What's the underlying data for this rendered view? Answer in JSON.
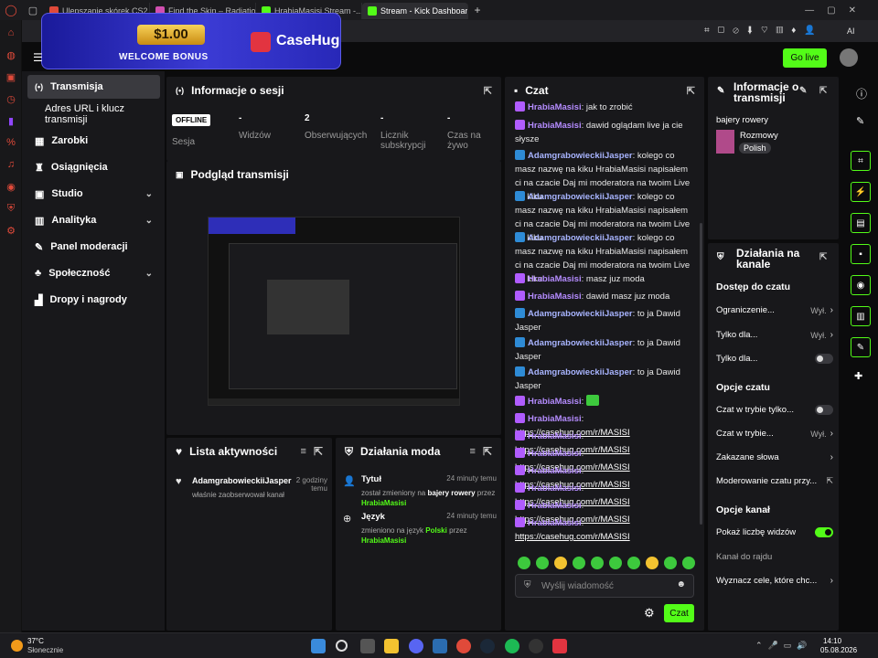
{
  "browser": {
    "tabs": [
      {
        "label": "Ulepszanie skórek CS2 i ul...",
        "color": "#e04a3a"
      },
      {
        "label": "Find the Skin – Radiation S...",
        "color": "#d04fb0"
      },
      {
        "label": "HrabiaMasisi Stream -...",
        "color": "#53fc18"
      },
      {
        "label": "Stream - Kick Dashboard",
        "color": "#53fc18"
      }
    ],
    "address_ai": "AI"
  },
  "banner": {
    "amount": "$1.00",
    "subtitle": "WELCOME BONUS",
    "brand": "CaseHug"
  },
  "header": {
    "go_live": "Go live"
  },
  "nav": {
    "items": [
      {
        "label": "Transmisja",
        "icon": "broadcast-icon"
      },
      {
        "label": "Adres URL i klucz transmisji"
      },
      {
        "label": "Zarobki",
        "icon": "chart-icon"
      },
      {
        "label": "Osiągnięcia",
        "icon": "trophy-icon"
      },
      {
        "label": "Studio",
        "icon": "studio-icon"
      },
      {
        "label": "Analityka",
        "icon": "analytics-icon"
      },
      {
        "label": "Panel moderacji",
        "icon": "wrench-icon"
      },
      {
        "label": "Społeczność",
        "icon": "community-icon"
      },
      {
        "label": "Dropy i nagrody",
        "icon": "gift-icon"
      }
    ]
  },
  "session": {
    "title": "Informacje o sesji",
    "status": "OFFLINE",
    "session_label": "Sesja",
    "stats": [
      {
        "value": "-",
        "label": "Widzów"
      },
      {
        "value": "2",
        "label": "Obserwujących"
      },
      {
        "value": "-",
        "label": "Licznik subskrypcji"
      },
      {
        "value": "-",
        "label": "Czas na żywo"
      }
    ]
  },
  "preview": {
    "title": "Podgląd transmisji"
  },
  "activity": {
    "title": "Lista aktywności",
    "items": [
      {
        "user": "AdamgrabowieckiiJasper",
        "text": "właśnie zaobserwował kanał",
        "time": "2 godziny temu"
      }
    ]
  },
  "modactions": {
    "title": "Działania moda",
    "items": [
      {
        "title": "Tytuł",
        "time": "24 minuty temu",
        "pre": "został zmieniony na",
        "value": "bajery rowery",
        "mid": "przez",
        "user": "HrabiaMasisi"
      },
      {
        "title": "Język",
        "time": "24 minuty temu",
        "pre": "zmieniono na język",
        "value": "Polski",
        "mid": "przez",
        "user": "HrabiaMasisi"
      }
    ]
  },
  "chat": {
    "title": "Czat",
    "messages": [
      {
        "user": "HrabiaMasisi",
        "badge": "purple",
        "text": ": jak to zrobić"
      },
      {
        "user": "HrabiaMasisi",
        "badge": "purple",
        "text": ": dawid oglądam live ja cie słysze"
      },
      {
        "user": "AdamgrabowieckiiJasper",
        "badge": "blue",
        "text": ": kolego co masz nazwę na kiku HrabiaMasisi napisałem ci na czacie Daj mi moderatora na twoim Live na kiku"
      },
      {
        "user": "AdamgrabowieckiiJasper",
        "badge": "blue",
        "text": ": kolego co masz nazwę na kiku HrabiaMasisi napisałem ci na czacie Daj mi moderatora na twoim Live na kiku"
      },
      {
        "user": "AdamgrabowieckiiJasper",
        "badge": "blue",
        "text": ": kolego co masz nazwę na kiku HrabiaMasisi napisałem ci na czacie Daj mi moderatora na twoim Live na kiku"
      },
      {
        "user": "HrabiaMasisi",
        "badge": "purple",
        "text": ": masz juz moda"
      },
      {
        "user": "HrabiaMasisi",
        "badge": "purple",
        "text": ": dawid masz juz moda"
      },
      {
        "user": "AdamgrabowieckiiJasper",
        "badge": "blue",
        "text": ": to ja Dawid Jasper"
      },
      {
        "user": "AdamgrabowieckiiJasper",
        "badge": "blue",
        "text": ": to ja Dawid Jasper"
      },
      {
        "user": "AdamgrabowieckiiJasper",
        "badge": "blue",
        "text": ": to ja Dawid Jasper"
      },
      {
        "user": "HrabiaMasisi",
        "badge": "purple",
        "text": ":",
        "emote": true
      },
      {
        "user": "HrabiaMasisi",
        "badge": "purple",
        "text": ": ",
        "link": "https://casehug.com/r/MASISI"
      },
      {
        "user": "HrabiaMasisi",
        "badge": "purple",
        "text": ": ",
        "link": "https://casehug.com/r/MASISI"
      },
      {
        "user": "HrabiaMasisi",
        "badge": "purple",
        "text": ": ",
        "link": "https://casehug.com/r/MASISI"
      },
      {
        "user": "HrabiaMasisi",
        "badge": "purple",
        "text": ": ",
        "link": "https://casehug.com/r/MASISI"
      },
      {
        "user": "HrabiaMasisi",
        "badge": "purple",
        "text": ": ",
        "link": "https://casehug.com/r/MASISI"
      },
      {
        "user": "HrabiaMasisi",
        "badge": "purple",
        "text": ": ",
        "link": "https://casehug.com/r/MASISI"
      },
      {
        "user": "HrabiaMasisi",
        "badge": "purple",
        "text": ": ",
        "link": "https://casehug.com/r/MASISI"
      }
    ],
    "input_placeholder": "Wyślij wiadomość",
    "send_label": "Czat"
  },
  "stream_info": {
    "title": "Informacje o transmisji",
    "stream_title": "bajery rowery",
    "category": "Rozmowy",
    "tag": "Polish"
  },
  "channel_actions": {
    "title": "Działania na kanale",
    "sections": [
      {
        "heading": "Dostęp do czatu",
        "rows": [
          {
            "label": "Ograniczenie...",
            "value": "Wył.",
            "type": "arrow"
          },
          {
            "label": "Tylko dla...",
            "value": "Wył.",
            "type": "arrow"
          },
          {
            "label": "Tylko dla...",
            "value": "",
            "type": "toggle",
            "on": false
          }
        ]
      },
      {
        "heading": "Opcje czatu",
        "rows": [
          {
            "label": "Czat w trybie tylko...",
            "value": "",
            "type": "toggle",
            "on": false
          },
          {
            "label": "Czat w trybie...",
            "value": "Wył.",
            "type": "arrow"
          },
          {
            "label": "Zakazane słowa",
            "value": "",
            "type": "arrow"
          },
          {
            "label": "Moderowanie czatu przy...",
            "value": "",
            "type": "external"
          }
        ]
      },
      {
        "heading": "Opcje kanał",
        "rows": [
          {
            "label": "Pokaż liczbę widzów",
            "value": "",
            "type": "toggle",
            "on": true
          },
          {
            "label": "Kanał do rajdu",
            "value": "",
            "type": "none"
          },
          {
            "label": "Wyznacz cele, które chc...",
            "value": "",
            "type": "arrow"
          }
        ]
      }
    ]
  },
  "taskbar": {
    "temp": "37°C",
    "weather": "Słonecznie",
    "time": "14:10",
    "date": "05.08.2026"
  },
  "colors": {
    "accent": "#53fc18",
    "panel": "#18181b",
    "bg": "#0b0b0c"
  }
}
